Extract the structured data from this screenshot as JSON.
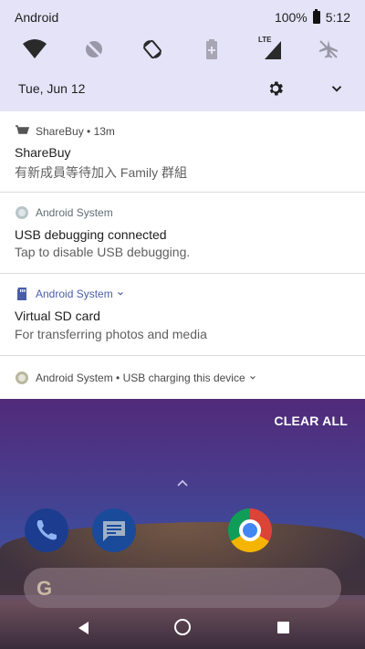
{
  "status_bar": {
    "carrier": "Android",
    "battery_percent": "100%",
    "time": "5:12"
  },
  "quick_settings": {
    "date": "Tue, Jun 12",
    "tiles": [
      "wifi-icon",
      "sync-off-icon",
      "auto-rotate-icon",
      "battery-saver-icon",
      "lte-signal-icon",
      "airplane-mode-icon"
    ],
    "lte_label": "LTE"
  },
  "notifications": [
    {
      "app": "ShareBuy",
      "time": "13m",
      "title": "ShareBuy",
      "text": "有新成員等待加入 Family 群組",
      "icon": "shopping-cart-icon"
    },
    {
      "app": "Android System",
      "title": "USB debugging connected",
      "text": "Tap to disable USB debugging.",
      "icon": "android-system-icon"
    },
    {
      "app": "Android System",
      "title": "Virtual SD card",
      "text": "For transferring photos and media",
      "icon": "sd-card-icon"
    },
    {
      "app": "Android System",
      "subtext": "USB charging this device",
      "icon": "android-system-icon"
    }
  ],
  "clear_all_label": "CLEAR ALL",
  "search_bar": {
    "logo_letter": "G"
  },
  "colors": {
    "shade_bg": "#e5e3f7",
    "notification_bg": "#ffffff",
    "accent": "#1f1f1f"
  }
}
